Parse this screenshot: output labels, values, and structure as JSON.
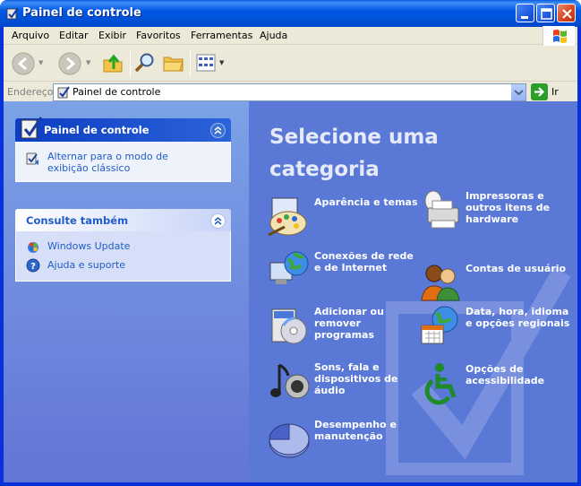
{
  "window": {
    "title": "Painel de controle"
  },
  "menu": [
    "Arquivo",
    "Editar",
    "Exibir",
    "Favoritos",
    "Ferramentas",
    "Ajuda"
  ],
  "address": {
    "label": "Endereço",
    "value": "Painel de controle",
    "go_label": "Ir"
  },
  "sidebar": {
    "panel1": {
      "title": "Painel de controle",
      "link": "Alternar para o modo de exibição clássico"
    },
    "panel2": {
      "title": "Consulte também",
      "links": [
        "Windows Update",
        "Ajuda e suporte"
      ]
    }
  },
  "main": {
    "title": "Selecione uma categoria",
    "categories": [
      {
        "label": "Aparência e temas",
        "icon": "appearance-icon"
      },
      {
        "label": "Impressoras e outros itens de hardware",
        "icon": "printer-icon"
      },
      {
        "label": "Conexões de rede e de Internet",
        "icon": "network-icon"
      },
      {
        "label": "Contas de usuário",
        "icon": "users-icon"
      },
      {
        "label": "Adicionar ou remover programas",
        "icon": "programs-icon"
      },
      {
        "label": "Data, hora, idioma e opções regionais",
        "icon": "calendar-globe-icon"
      },
      {
        "label": "Sons, fala e dispositivos de áudio",
        "icon": "sound-icon"
      },
      {
        "label": "Opções de acessibilidade",
        "icon": "accessibility-icon"
      },
      {
        "label": "Desempenho e manutenção",
        "icon": "performance-icon"
      }
    ]
  },
  "colors": {
    "title_bar": "#0054e3",
    "sidebar_bg": "#7ba2e7",
    "main_bg": "#5a78d6",
    "link": "#215dc6"
  }
}
